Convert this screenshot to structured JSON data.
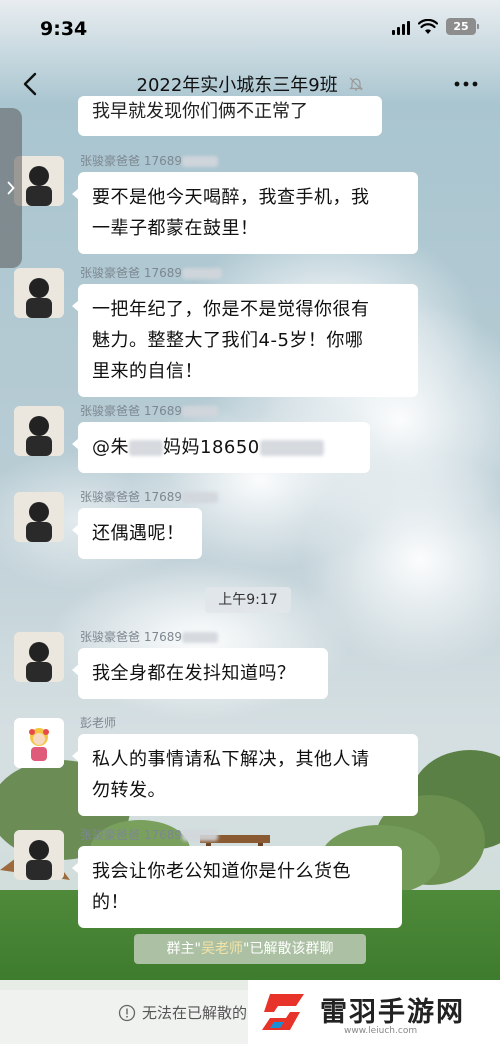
{
  "status_bar": {
    "time": "9:34",
    "battery": "25"
  },
  "header": {
    "title": "2022年实小城东三年9班"
  },
  "partial_message": "我早就发现你们俩不正常了",
  "messages": [
    {
      "sender": "张骏豪爸爸 17689",
      "text": [
        "要不是他今天喝醉，我查手机，我",
        "一辈子都蒙在鼓里！"
      ]
    },
    {
      "sender": "张骏豪爸爸 17689",
      "text": [
        "一把年纪了，你是不是觉得你很有",
        "魅力。整整大了我们4-5岁！你哪",
        "里来的自信！"
      ]
    },
    {
      "sender": "张骏豪爸爸 17689",
      "text_parts": [
        "@朱",
        "妈妈18650"
      ]
    },
    {
      "sender": "张骏豪爸爸 17689",
      "text": [
        "还偶遇呢！"
      ]
    },
    {
      "sender": "张骏豪爸爸 17689",
      "text": [
        "我全身都在发抖知道吗？"
      ]
    },
    {
      "sender": "彭老师",
      "text": [
        "私人的事情请私下解决，其他人请",
        "勿转发。"
      ]
    },
    {
      "sender": "张骏豪爸爸 17689",
      "text": [
        "我会让你老公知道你是什么货色",
        "的！"
      ]
    }
  ],
  "timestamp": "上午9:17",
  "system_notice": {
    "prefix": "群主\"",
    "name": "吴老师",
    "suffix": "\"已解散该群聊"
  },
  "bottom_notice": "无法在已解散的",
  "watermark": {
    "name": "雷羽手游网",
    "url": "www.leiuch.com"
  },
  "colors": {
    "bubble": "#ffffff",
    "sender": "#7d8790",
    "brand_red": "#e8332a"
  }
}
